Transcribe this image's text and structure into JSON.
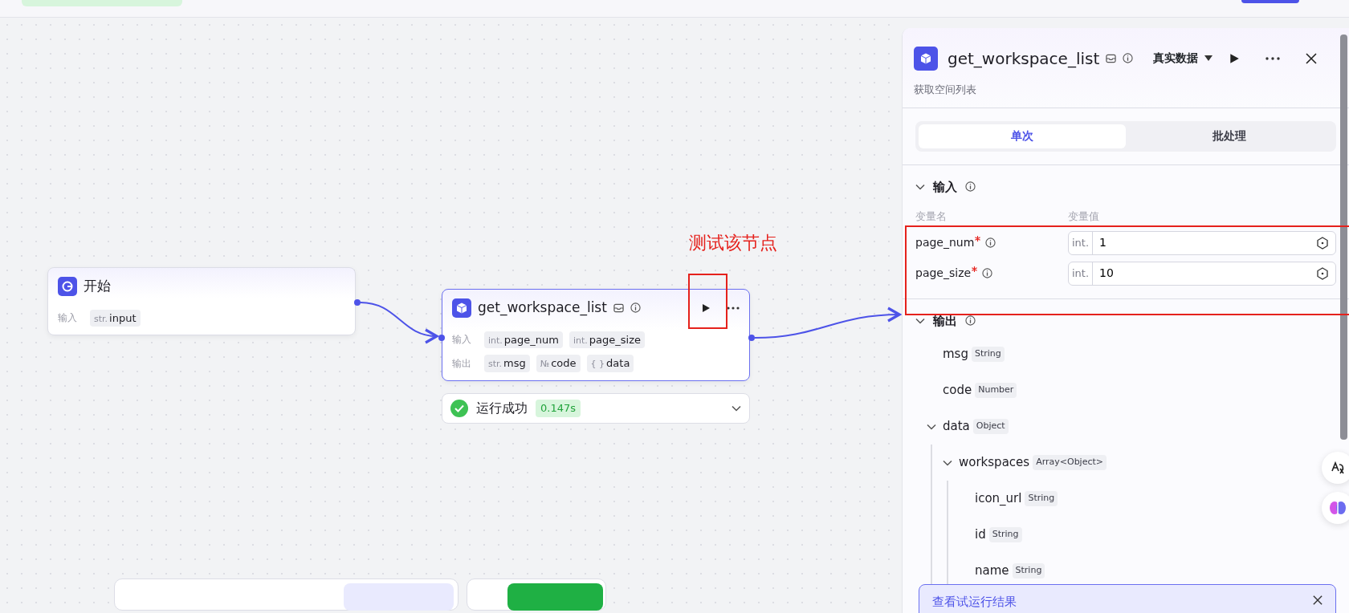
{
  "annotation": {
    "text": "测试该节点"
  },
  "nodes": [
    {
      "kind": "start",
      "title": "开始",
      "selected": false,
      "rows": [
        {
          "label": "输入",
          "params": [
            {
              "type": "str.",
              "name": "input"
            }
          ]
        }
      ]
    },
    {
      "kind": "plugin",
      "title": "get_workspace_list",
      "selected": true,
      "rows": [
        {
          "label": "输入",
          "params": [
            {
              "type": "int.",
              "name": "page_num"
            },
            {
              "type": "int.",
              "name": "page_size"
            }
          ]
        },
        {
          "label": "输出",
          "params": [
            {
              "type": "str.",
              "name": "msg"
            },
            {
              "type": "№",
              "name": "code"
            },
            {
              "type": "{ }",
              "name": "data"
            }
          ]
        }
      ],
      "status": {
        "text": "运行成功",
        "time": "0.147s"
      }
    }
  ],
  "panel": {
    "title": "get_workspace_list",
    "mode": "真实数据",
    "description": "获取空间列表",
    "tabs": [
      {
        "label": "单次",
        "selected": true
      },
      {
        "label": "批处理",
        "selected": false
      }
    ],
    "input": {
      "title": "输入",
      "expanded": true,
      "columns": [
        "变量名",
        "变量值"
      ],
      "params": [
        {
          "name": "page_num",
          "required": true,
          "type": "int.",
          "value": "1"
        },
        {
          "name": "page_size",
          "required": true,
          "type": "int.",
          "value": "10"
        }
      ]
    },
    "output": {
      "title": "输出",
      "expanded": true,
      "fields": [
        {
          "name": "msg",
          "type": "String"
        },
        {
          "name": "code",
          "type": "Number"
        },
        {
          "name": "data",
          "type": "Object",
          "expanded": true,
          "children": [
            {
              "name": "workspaces",
              "type": "Array<Object>",
              "expanded": true,
              "children": [
                {
                  "name": "icon_url",
                  "type": "String"
                },
                {
                  "name": "id",
                  "type": "String"
                },
                {
                  "name": "name",
                  "type": "String"
                }
              ]
            }
          ]
        }
      ]
    },
    "banner": {
      "text": "查看试运行结果"
    }
  }
}
